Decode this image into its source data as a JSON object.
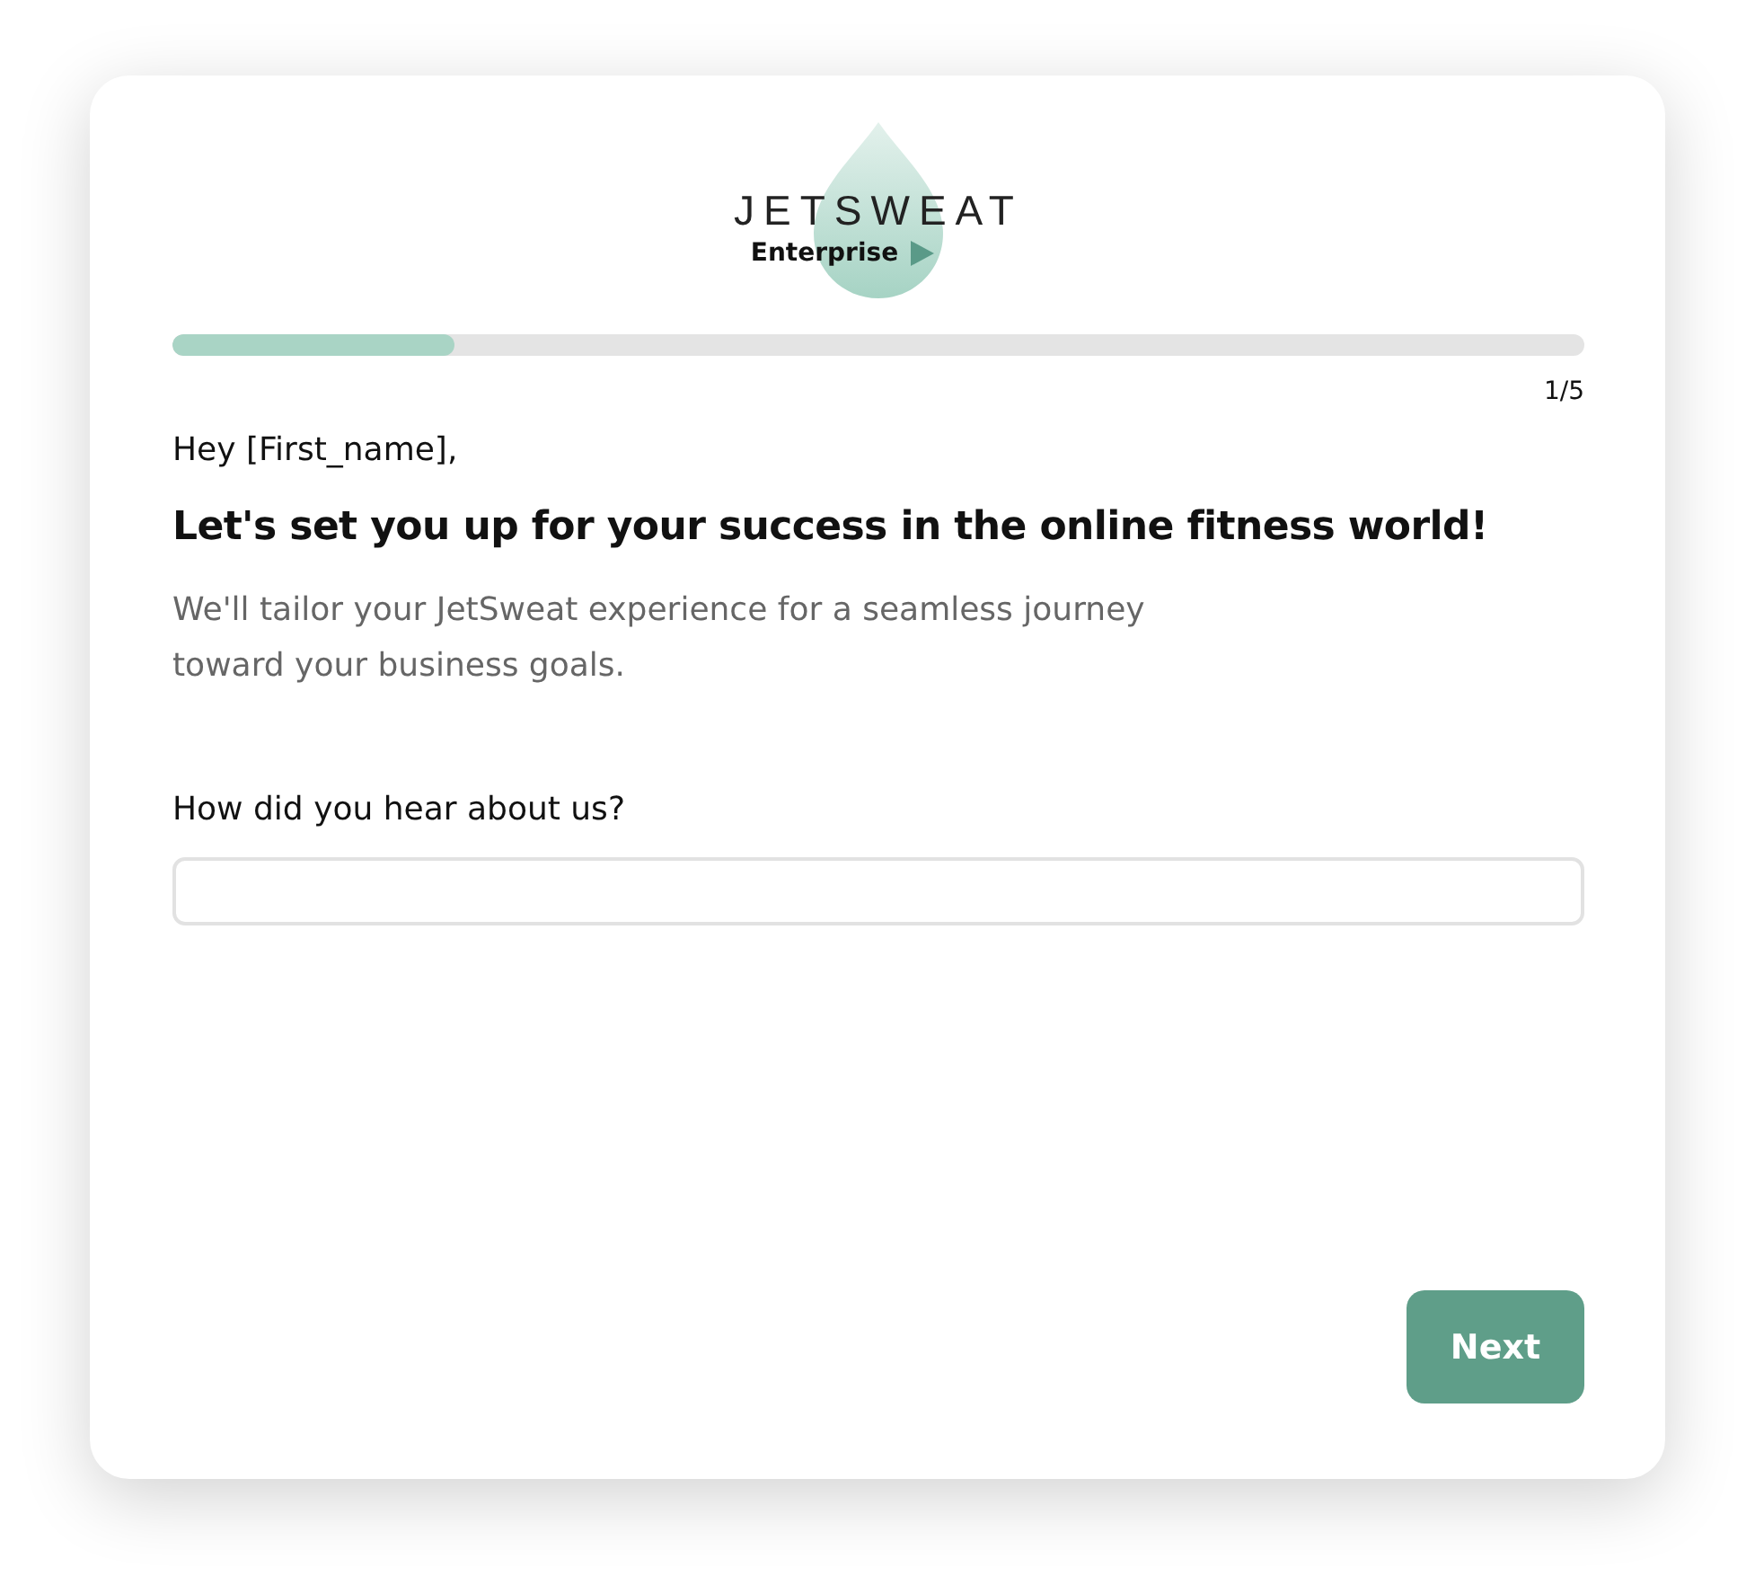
{
  "logo": {
    "wordmark": "JETSWEAT",
    "subtitle": "Enterprise"
  },
  "progress": {
    "level": 0.2,
    "step": "1/5"
  },
  "greeting": "Hey [First_name],",
  "heading": "Let's set you up for your success in the online fitness world!",
  "intro": "We'll tailor your JetSweat experience for a seamless journey toward your business goals.",
  "question": {
    "label": "How did you hear about us?"
  },
  "buttons": [
    {
      "label": "Next",
      "kind": "primary"
    }
  ]
}
